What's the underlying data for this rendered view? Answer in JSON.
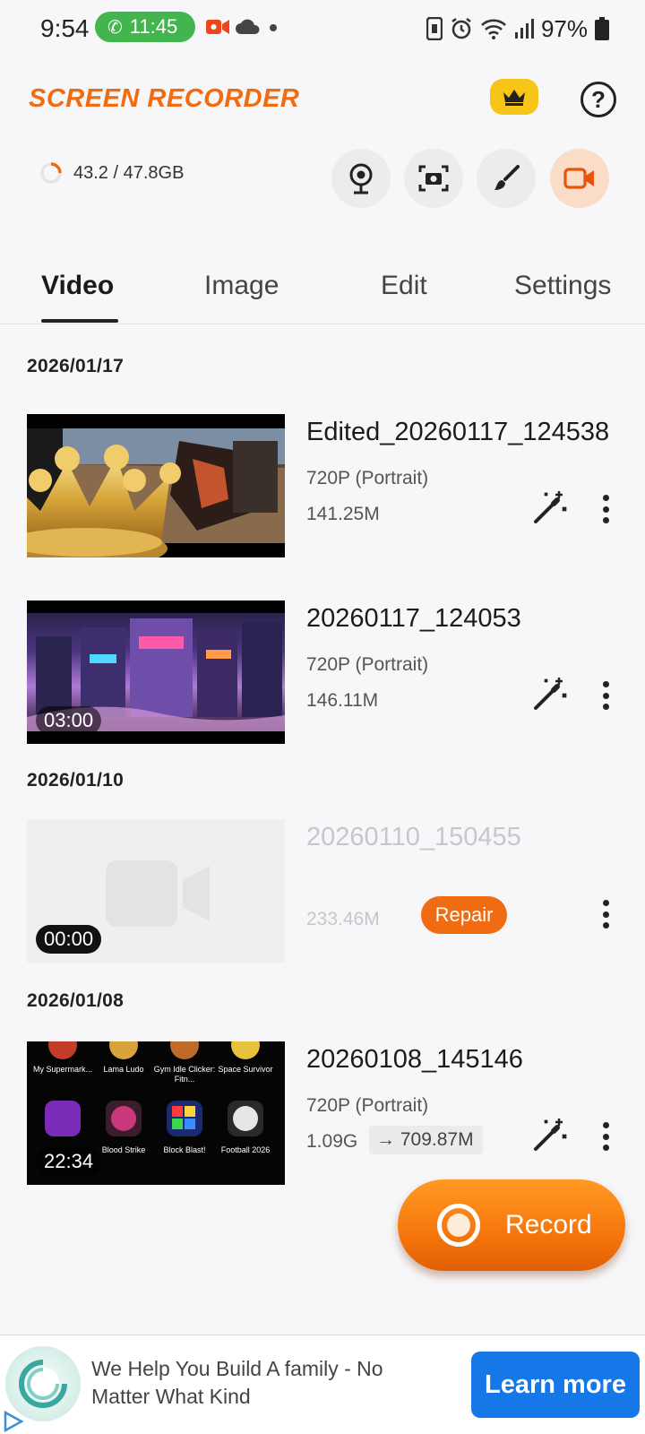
{
  "status_bar": {
    "time": "9:54",
    "call_timer": "11:45",
    "battery": "97%"
  },
  "app": {
    "title": "SCREEN RECORDER",
    "storage": "43.2 / 47.8GB",
    "accent": "#f26b0f"
  },
  "tools": [
    "webcam-icon",
    "screenshot-icon",
    "brush-icon",
    "video-record-icon"
  ],
  "tabs": [
    {
      "label": "Video",
      "active": true
    },
    {
      "label": "Image",
      "active": false
    },
    {
      "label": "Edit",
      "active": false
    },
    {
      "label": "Settings",
      "active": false
    }
  ],
  "groups": [
    {
      "date": "2026/01/17"
    },
    {
      "date": "2026/01/10"
    },
    {
      "date": "2026/01/08"
    }
  ],
  "videos": [
    {
      "title": "Edited_20260117_124538",
      "resolution": "720P (Portrait)",
      "size": "141.25M",
      "duration": ""
    },
    {
      "title": "20260117_124053",
      "resolution": "720P (Portrait)",
      "size": "146.11M",
      "duration": "03:00"
    },
    {
      "title": "20260110_150455",
      "resolution": "",
      "size": "233.46M",
      "duration": "00:00",
      "action": "Repair"
    },
    {
      "title": "20260108_145146",
      "resolution": "720P (Portrait)",
      "size": "1.09G",
      "compressed_size": "→ 709.87M",
      "duration": "22:34"
    }
  ],
  "thumb4_apps": [
    {
      "label": "My Supermark..."
    },
    {
      "label": "Lama Ludo"
    },
    {
      "label": "Gym Idle Clicker: Fitn..."
    },
    {
      "label": "Space Survivor"
    },
    {
      "label": "Blood Strike"
    },
    {
      "label": "Block Blast!"
    },
    {
      "label": "Football 2026"
    }
  ],
  "record_button": {
    "label": "Record"
  },
  "ad": {
    "text": "We Help You Build A family - No Matter What Kind",
    "cta": "Learn more"
  }
}
